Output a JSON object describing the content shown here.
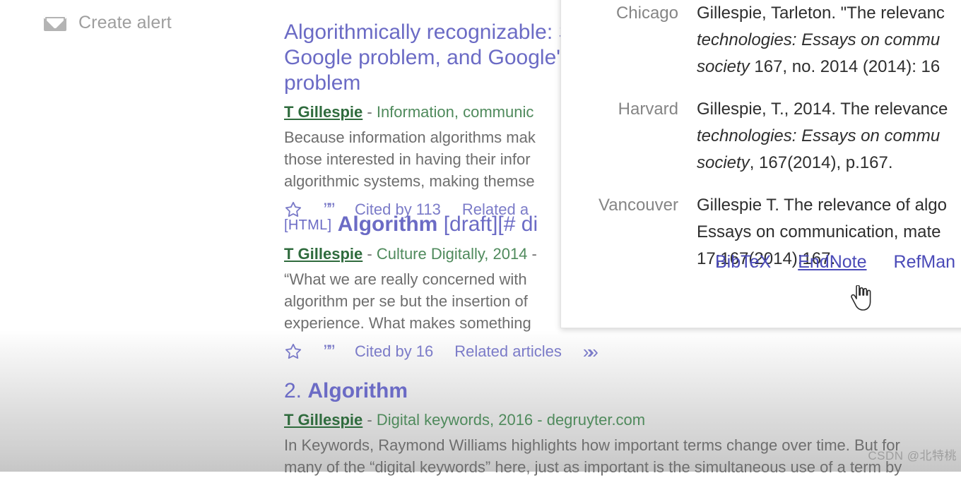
{
  "sidebar": {
    "alert": {
      "icon": "envelope-icon",
      "label": "Create alert"
    }
  },
  "results": [
    {
      "title_plain": "Algorithmically recognizable: Santorum's Google problem, and Google's Santorum problem",
      "title_visible_line1": "Algorithmically recognizable",
      "title_visible_line2": "Santorum problem",
      "authors": "T Gillespie",
      "author_name": "T Gillespie",
      "venue": "Information, communic",
      "snippet_line1": "Because information algorithms mak",
      "snippet_line2": "those interested in having their infor",
      "snippet_line3": "algorithmic systems, making themse",
      "actions": {
        "save_icon": "star-icon",
        "cite_icon": "quote-icon",
        "cited_by": "Cited by 113",
        "related": "Related a"
      }
    },
    {
      "tag": "[HTML]",
      "title_bold": "Algorithm",
      "title_rest": "[draft][# di",
      "authors": "T Gillespie",
      "venue": "Culture Digitally, 2014",
      "snippet_line1": "“What we are really concerned with",
      "snippet_line2": "algorithm per se but the insertion of",
      "snippet_line3": "experience. What makes something",
      "actions": {
        "save_icon": "star-icon",
        "cite_icon": "quote-icon",
        "cited_by": "Cited by 16",
        "related": "Related articles",
        "more_icon": "double-chevron-icon"
      }
    },
    {
      "number_prefix": "2.",
      "title_bold": "Algorithm",
      "authors": "T Gillespie",
      "venue": "Digital keywords, 2016 - degruyter.com",
      "snippet_line1": "In Keywords, Raymond Williams highlights how important terms change over time. But for",
      "snippet_line2": "many of the “digital keywords” here, just as important is the simultaneous use of a term by"
    }
  ],
  "cite_popup": {
    "rows": [
      {
        "style": "Chicago",
        "line1_pre": "Gillespie, Tarleton. \"The relevanc",
        "line2_italic": "technologies: Essays on commu",
        "line3_italic": "society",
        "line3_rest": " 167, no. 2014 (2014): 16"
      },
      {
        "style": "Harvard",
        "line1_pre": "Gillespie, T., 2014. The relevance",
        "line2_italic": "technologies: Essays on commu",
        "line3_italic": "society",
        "line3_rest": ", 167(2014), p.167."
      },
      {
        "style": "Vancouver",
        "line1_pre": "Gillespie T. The relevance of algo",
        "line2_italic": "",
        "line2_plain": "Essays on communication, mate",
        "line3_italic": "",
        "line3_rest": "17;167(2014):167."
      }
    ],
    "export_links": [
      {
        "label": "BibTeX",
        "hovered": false
      },
      {
        "label": "EndNote",
        "hovered": true
      },
      {
        "label": "RefMan",
        "hovered": false
      }
    ],
    "cursor": "hand-pointer-cursor"
  },
  "watermark": {
    "text": "CSDN @北特桃"
  },
  "colors": {
    "link_purple": "#6b6bc5",
    "export_link": "#4a4ab8",
    "venue_green": "#4f8a5c",
    "author_green": "#2f6b3d",
    "snippet_gray": "#6e6e6e",
    "style_label_gray": "#858585",
    "alert_gray": "#9e9e9e"
  }
}
